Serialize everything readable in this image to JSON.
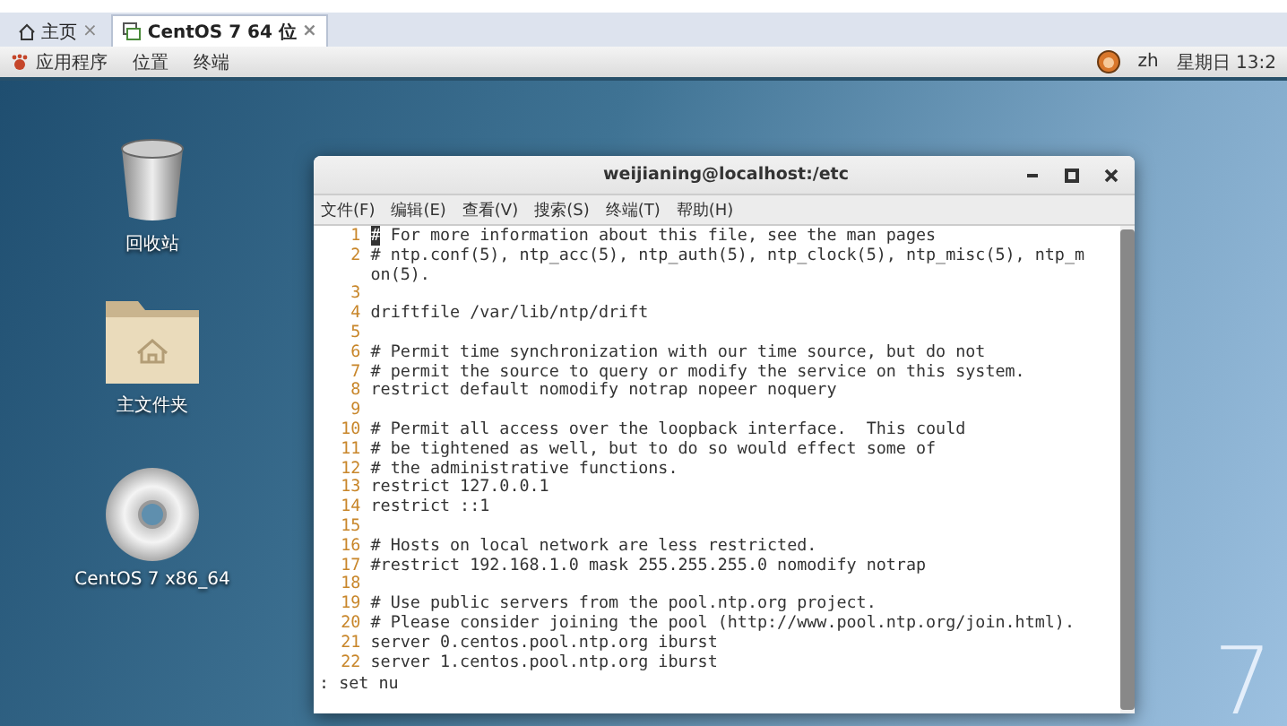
{
  "tabs": [
    {
      "label": "主页",
      "close": "×",
      "selected": false
    },
    {
      "label": "CentOS 7 64 位",
      "close": "×",
      "selected": true
    }
  ],
  "top_bar": {
    "menus": [
      "应用程序",
      "位置",
      "终端"
    ],
    "language": "zh",
    "clock": "星期日 13:2"
  },
  "desktop": {
    "icons": [
      {
        "kind": "trash",
        "label": "回收站"
      },
      {
        "kind": "folder",
        "label": "主文件夹"
      },
      {
        "kind": "disc",
        "label": "CentOS 7 x86_64"
      }
    ],
    "wallpaper_mark": "7"
  },
  "terminal": {
    "title": "weijianing@localhost:/etc",
    "menu": [
      "文件(F)",
      "编辑(E)",
      "查看(V)",
      "搜索(S)",
      "终端(T)",
      "帮助(H)"
    ],
    "lines": [
      {
        "number": "1",
        "text": "# For more information about this file, see the man pages",
        "cursor": true
      },
      {
        "number": "2",
        "text": "# ntp.conf(5), ntp_acc(5), ntp_auth(5), ntp_clock(5), ntp_misc(5), ntp_mon(5).",
        "cursor": false
      },
      {
        "number": "3",
        "cursor": false
      },
      {
        "number": "4",
        "text": "driftfile /var/lib/ntp/drift",
        "cursor": false
      },
      {
        "number": "5",
        "cursor": false
      },
      {
        "number": "6",
        "text": "# Permit time synchronization with our time source, but do not",
        "cursor": false
      },
      {
        "number": "7",
        "text": "# permit the source to query or modify the service on this system.",
        "cursor": false
      },
      {
        "number": "8",
        "text": "restrict default nomodify notrap nopeer noquery",
        "cursor": false
      },
      {
        "number": "9",
        "cursor": false
      },
      {
        "number": "10",
        "text": "# Permit all access over the loopback interface.  This could",
        "cursor": false
      },
      {
        "number": "11",
        "text": "# be tightened as well, but to do so would effect some of",
        "cursor": false
      },
      {
        "number": "12",
        "text": "# the administrative functions.",
        "cursor": false
      },
      {
        "number": "13",
        "text": "restrict 127.0.0.1",
        "cursor": false
      },
      {
        "number": "14",
        "text": "restrict ::1",
        "cursor": false
      },
      {
        "number": "15",
        "cursor": false
      },
      {
        "number": "16",
        "text": "# Hosts on local network are less restricted.",
        "cursor": false
      },
      {
        "number": "17",
        "text": "#restrict 192.168.1.0 mask 255.255.255.0 nomodify notrap",
        "cursor": false
      },
      {
        "number": "18",
        "cursor": false
      },
      {
        "number": "19",
        "text": "# Use public servers from the pool.ntp.org project.",
        "cursor": false
      },
      {
        "number": "20",
        "text": "# Please consider joining the pool (http://www.pool.ntp.org/join.html).",
        "cursor": false
      },
      {
        "number": "21",
        "text": "server 0.centos.pool.ntp.org iburst",
        "cursor": false
      },
      {
        "number": "22",
        "text": "server 1.centos.pool.ntp.org iburst",
        "cursor": false
      }
    ],
    "command_line": ": set nu"
  }
}
